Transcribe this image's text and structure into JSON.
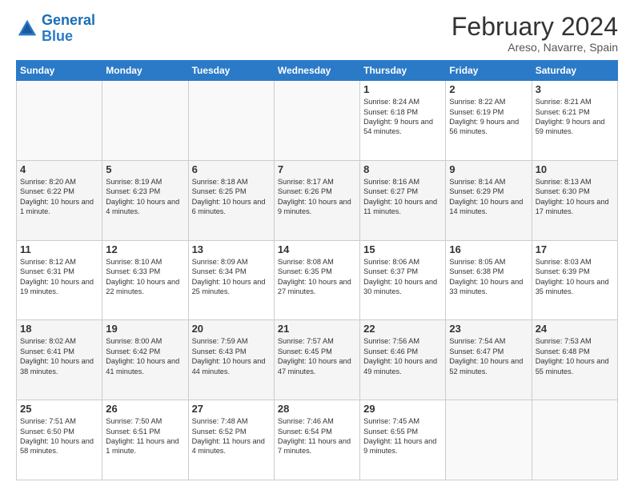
{
  "header": {
    "logo_line1": "General",
    "logo_line2": "Blue",
    "month_title": "February 2024",
    "location": "Areso, Navarre, Spain"
  },
  "days_of_week": [
    "Sunday",
    "Monday",
    "Tuesday",
    "Wednesday",
    "Thursday",
    "Friday",
    "Saturday"
  ],
  "weeks": [
    [
      {
        "day": "",
        "info": ""
      },
      {
        "day": "",
        "info": ""
      },
      {
        "day": "",
        "info": ""
      },
      {
        "day": "",
        "info": ""
      },
      {
        "day": "1",
        "info": "Sunrise: 8:24 AM\nSunset: 6:18 PM\nDaylight: 9 hours\nand 54 minutes."
      },
      {
        "day": "2",
        "info": "Sunrise: 8:22 AM\nSunset: 6:19 PM\nDaylight: 9 hours\nand 56 minutes."
      },
      {
        "day": "3",
        "info": "Sunrise: 8:21 AM\nSunset: 6:21 PM\nDaylight: 9 hours\nand 59 minutes."
      }
    ],
    [
      {
        "day": "4",
        "info": "Sunrise: 8:20 AM\nSunset: 6:22 PM\nDaylight: 10 hours\nand 1 minute."
      },
      {
        "day": "5",
        "info": "Sunrise: 8:19 AM\nSunset: 6:23 PM\nDaylight: 10 hours\nand 4 minutes."
      },
      {
        "day": "6",
        "info": "Sunrise: 8:18 AM\nSunset: 6:25 PM\nDaylight: 10 hours\nand 6 minutes."
      },
      {
        "day": "7",
        "info": "Sunrise: 8:17 AM\nSunset: 6:26 PM\nDaylight: 10 hours\nand 9 minutes."
      },
      {
        "day": "8",
        "info": "Sunrise: 8:16 AM\nSunset: 6:27 PM\nDaylight: 10 hours\nand 11 minutes."
      },
      {
        "day": "9",
        "info": "Sunrise: 8:14 AM\nSunset: 6:29 PM\nDaylight: 10 hours\nand 14 minutes."
      },
      {
        "day": "10",
        "info": "Sunrise: 8:13 AM\nSunset: 6:30 PM\nDaylight: 10 hours\nand 17 minutes."
      }
    ],
    [
      {
        "day": "11",
        "info": "Sunrise: 8:12 AM\nSunset: 6:31 PM\nDaylight: 10 hours\nand 19 minutes."
      },
      {
        "day": "12",
        "info": "Sunrise: 8:10 AM\nSunset: 6:33 PM\nDaylight: 10 hours\nand 22 minutes."
      },
      {
        "day": "13",
        "info": "Sunrise: 8:09 AM\nSunset: 6:34 PM\nDaylight: 10 hours\nand 25 minutes."
      },
      {
        "day": "14",
        "info": "Sunrise: 8:08 AM\nSunset: 6:35 PM\nDaylight: 10 hours\nand 27 minutes."
      },
      {
        "day": "15",
        "info": "Sunrise: 8:06 AM\nSunset: 6:37 PM\nDaylight: 10 hours\nand 30 minutes."
      },
      {
        "day": "16",
        "info": "Sunrise: 8:05 AM\nSunset: 6:38 PM\nDaylight: 10 hours\nand 33 minutes."
      },
      {
        "day": "17",
        "info": "Sunrise: 8:03 AM\nSunset: 6:39 PM\nDaylight: 10 hours\nand 35 minutes."
      }
    ],
    [
      {
        "day": "18",
        "info": "Sunrise: 8:02 AM\nSunset: 6:41 PM\nDaylight: 10 hours\nand 38 minutes."
      },
      {
        "day": "19",
        "info": "Sunrise: 8:00 AM\nSunset: 6:42 PM\nDaylight: 10 hours\nand 41 minutes."
      },
      {
        "day": "20",
        "info": "Sunrise: 7:59 AM\nSunset: 6:43 PM\nDaylight: 10 hours\nand 44 minutes."
      },
      {
        "day": "21",
        "info": "Sunrise: 7:57 AM\nSunset: 6:45 PM\nDaylight: 10 hours\nand 47 minutes."
      },
      {
        "day": "22",
        "info": "Sunrise: 7:56 AM\nSunset: 6:46 PM\nDaylight: 10 hours\nand 49 minutes."
      },
      {
        "day": "23",
        "info": "Sunrise: 7:54 AM\nSunset: 6:47 PM\nDaylight: 10 hours\nand 52 minutes."
      },
      {
        "day": "24",
        "info": "Sunrise: 7:53 AM\nSunset: 6:48 PM\nDaylight: 10 hours\nand 55 minutes."
      }
    ],
    [
      {
        "day": "25",
        "info": "Sunrise: 7:51 AM\nSunset: 6:50 PM\nDaylight: 10 hours\nand 58 minutes."
      },
      {
        "day": "26",
        "info": "Sunrise: 7:50 AM\nSunset: 6:51 PM\nDaylight: 11 hours\nand 1 minute."
      },
      {
        "day": "27",
        "info": "Sunrise: 7:48 AM\nSunset: 6:52 PM\nDaylight: 11 hours\nand 4 minutes."
      },
      {
        "day": "28",
        "info": "Sunrise: 7:46 AM\nSunset: 6:54 PM\nDaylight: 11 hours\nand 7 minutes."
      },
      {
        "day": "29",
        "info": "Sunrise: 7:45 AM\nSunset: 6:55 PM\nDaylight: 11 hours\nand 9 minutes."
      },
      {
        "day": "",
        "info": ""
      },
      {
        "day": "",
        "info": ""
      }
    ]
  ]
}
